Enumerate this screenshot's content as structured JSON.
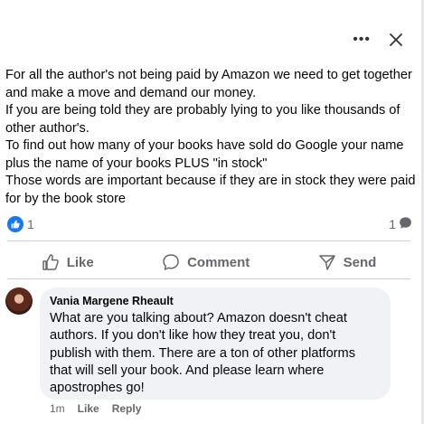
{
  "post": {
    "paragraphs": [
      "For all the author's not being paid by Amazon we need to get together and make a move and demand our money.",
      "If you are being told they are probably lying to you like thousands of other author's.",
      "To find out how many of your books have sold do Google your name plus the name of your books PLUS \"in stock\"",
      "Those words are important because if they are in stock they were paid for by the book store"
    ],
    "like_count": "1",
    "comment_count": "1"
  },
  "actions": {
    "like": "Like",
    "comment": "Comment",
    "send": "Send"
  },
  "comment": {
    "author": "Vania Margene Rheault",
    "text": "What are you talking about? Amazon doesn't cheat authors. If you don't like how they treat you, don't publish with them. There are a ton of other platforms that will sell your book. And please learn where apostrophes go!",
    "time": "1m",
    "like": "Like",
    "reply": "Reply"
  },
  "icons": {
    "more": "more-options-icon",
    "close": "close-icon",
    "like_reaction": "thumbs-up-icon",
    "comment_count": "speech-bubble-icon",
    "like_action": "thumbs-up-outline-icon",
    "comment_action": "comment-outline-icon",
    "send_action": "send-outline-icon"
  },
  "colors": {
    "accent": "#1877f2",
    "secondary_text": "#65676b",
    "bubble": "#f0f2f5"
  }
}
